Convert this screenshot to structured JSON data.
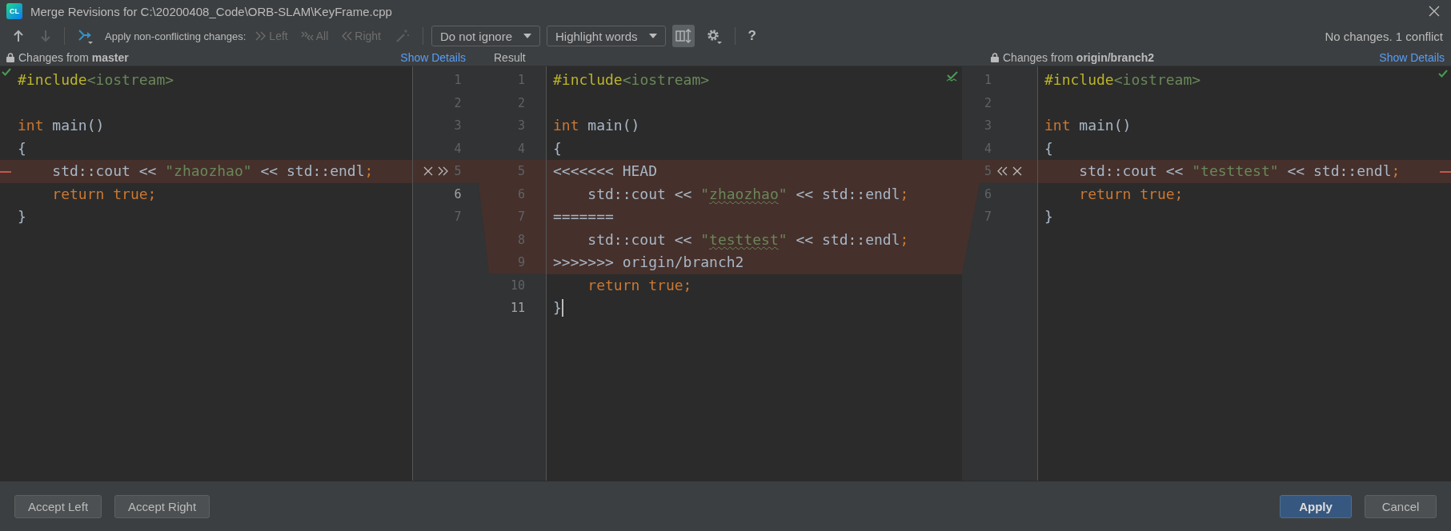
{
  "window": {
    "app_badge": "CL",
    "title": "Merge Revisions for C:\\20200408_Code\\ORB-SLAM\\KeyFrame.cpp"
  },
  "toolbar": {
    "nav": [
      {
        "kind": "up",
        "disabled": false
      },
      {
        "kind": "down",
        "disabled": true
      }
    ],
    "apply_label": "Apply non-conflicting changes:",
    "apply_buttons": [
      {
        "kind": "left",
        "label": "Left",
        "disabled": true
      },
      {
        "kind": "all",
        "label": "All",
        "disabled": true
      },
      {
        "kind": "right",
        "label": "Right",
        "disabled": true
      }
    ],
    "whitespace_dropdown": "Do not ignore",
    "highlight_dropdown": "Highlight words",
    "view_toggle": {
      "on": true
    },
    "help": "?",
    "status": "No changes. 1 conflict"
  },
  "left": {
    "label": "Changes from **master**",
    "show_details": "Show Details",
    "lines": [
      {
        "number": "1",
        "current": false,
        "changed": false,
        "tokens": [
          {
            "text": "#include",
            "kind": "directive"
          },
          {
            "text": "<iostream>",
            "kind": "path"
          }
        ]
      },
      {
        "number": "2",
        "current": false,
        "changed": false
      },
      {
        "number": "3",
        "current": false,
        "changed": false,
        "tokens": [
          {
            "text": "int",
            "kind": "keyword"
          },
          {
            "text": " main()",
            "kind": "plain"
          }
        ]
      },
      {
        "number": "4",
        "current": false,
        "changed": false,
        "tokens": [
          {
            "text": "{",
            "kind": "plain"
          }
        ]
      },
      {
        "number": "5",
        "current": false,
        "changed": true,
        "tokens": [
          {
            "text": "    std::cout << ",
            "kind": "plain"
          },
          {
            "text": "\"zhaozhao\"",
            "kind": "string"
          },
          {
            "text": " << std::endl",
            "kind": "plain"
          },
          {
            "text": ";",
            "kind": "keyword"
          }
        ]
      },
      {
        "number": "6",
        "current": true,
        "changed": false,
        "tokens": [
          {
            "text": "    return true;",
            "kind": "keyword"
          }
        ]
      },
      {
        "number": "7",
        "current": false,
        "changed": false,
        "tokens": [
          {
            "text": "}",
            "kind": "plain"
          }
        ]
      }
    ]
  },
  "result": {
    "label": "Result",
    "lines": [
      {
        "number": "1",
        "current": false,
        "changed": false,
        "tokens": [
          {
            "text": "#include",
            "kind": "directive"
          },
          {
            "text": "<iostream>",
            "kind": "path"
          }
        ]
      },
      {
        "number": "2",
        "current": false,
        "changed": false
      },
      {
        "number": "3",
        "current": false,
        "changed": false,
        "tokens": [
          {
            "text": "int",
            "kind": "keyword"
          },
          {
            "text": " main()",
            "kind": "plain"
          }
        ]
      },
      {
        "number": "4",
        "current": false,
        "changed": false,
        "tokens": [
          {
            "text": "{",
            "kind": "plain"
          }
        ]
      },
      {
        "number": "5",
        "current": false,
        "changed": true,
        "tokens": [
          {
            "text": "<<<<<<< HEAD",
            "kind": "plain"
          }
        ]
      },
      {
        "number": "6",
        "current": false,
        "changed": true,
        "tokens": [
          {
            "text": "    std::cout << ",
            "kind": "plain"
          },
          {
            "text": "\"",
            "kind": "string"
          },
          {
            "text": "zhaozhao",
            "kind": "string",
            "typo": true
          },
          {
            "text": "\"",
            "kind": "string"
          },
          {
            "text": " << std::endl",
            "kind": "plain"
          },
          {
            "text": ";",
            "kind": "keyword"
          }
        ]
      },
      {
        "number": "7",
        "current": false,
        "changed": true,
        "tokens": [
          {
            "text": "=======",
            "kind": "plain"
          }
        ]
      },
      {
        "number": "8",
        "current": false,
        "changed": true,
        "tokens": [
          {
            "text": "    std::cout << ",
            "kind": "plain"
          },
          {
            "text": "\"",
            "kind": "string"
          },
          {
            "text": "testtest",
            "kind": "string",
            "typo": true
          },
          {
            "text": "\"",
            "kind": "string"
          },
          {
            "text": " << std::endl",
            "kind": "plain"
          },
          {
            "text": ";",
            "kind": "keyword"
          }
        ]
      },
      {
        "number": "9",
        "current": false,
        "changed": true,
        "tokens": [
          {
            "text": ">>>>>>> origin/branch2",
            "kind": "plain"
          }
        ]
      },
      {
        "number": "10",
        "current": false,
        "changed": false,
        "tokens": [
          {
            "text": "    return true;",
            "kind": "keyword"
          }
        ]
      },
      {
        "number": "11",
        "current": true,
        "changed": false,
        "caret": true,
        "tokens": [
          {
            "text": "}",
            "kind": "plain"
          }
        ]
      }
    ]
  },
  "right": {
    "label": "Changes from **origin/branch2**",
    "show_details": "Show Details",
    "lines": [
      {
        "number": "1",
        "current": false,
        "changed": false,
        "tokens": [
          {
            "text": "#include",
            "kind": "directive"
          },
          {
            "text": "<iostream>",
            "kind": "path"
          }
        ]
      },
      {
        "number": "2",
        "current": false,
        "changed": false
      },
      {
        "number": "3",
        "current": false,
        "changed": false,
        "tokens": [
          {
            "text": "int",
            "kind": "keyword"
          },
          {
            "text": " main()",
            "kind": "plain"
          }
        ]
      },
      {
        "number": "4",
        "current": false,
        "changed": false,
        "tokens": [
          {
            "text": "{",
            "kind": "plain"
          }
        ]
      },
      {
        "number": "5",
        "current": false,
        "changed": true,
        "tokens": [
          {
            "text": "    std::cout << ",
            "kind": "plain"
          },
          {
            "text": "\"testtest\"",
            "kind": "string"
          },
          {
            "text": " << std::endl",
            "kind": "plain"
          },
          {
            "text": ";",
            "kind": "keyword"
          }
        ]
      },
      {
        "number": "6",
        "current": false,
        "changed": false,
        "tokens": [
          {
            "text": "    return true;",
            "kind": "keyword"
          }
        ]
      },
      {
        "number": "7",
        "current": false,
        "changed": false,
        "tokens": [
          {
            "text": "}",
            "kind": "plain"
          }
        ]
      }
    ]
  },
  "buttons": [
    {
      "kind": "secondary",
      "label": "Accept Left"
    },
    {
      "kind": "secondary",
      "label": "Accept Right"
    },
    {
      "kind": "primary",
      "label": "Apply"
    },
    {
      "kind": "secondary",
      "label": "Cancel"
    }
  ]
}
